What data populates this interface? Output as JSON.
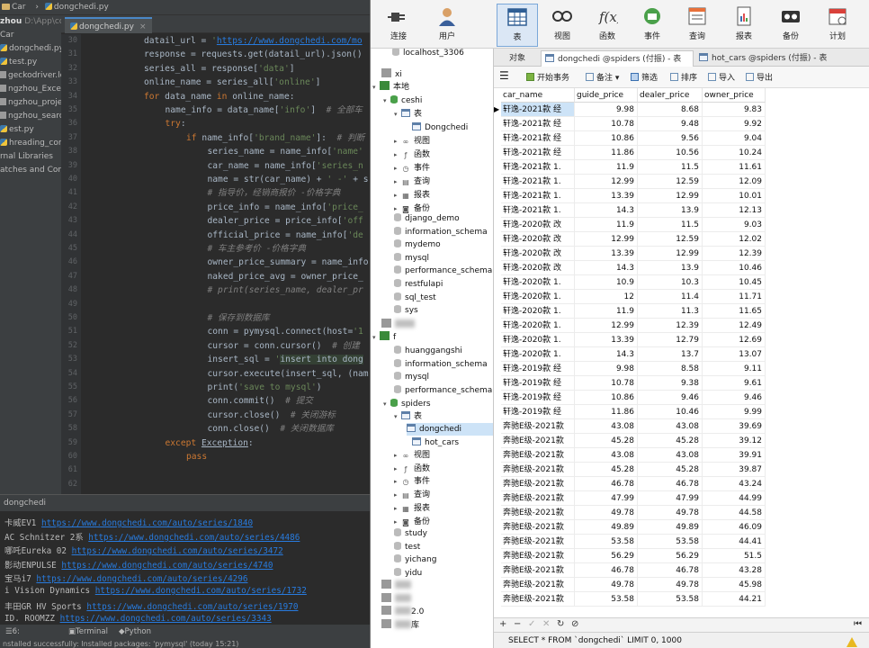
{
  "ide": {
    "breadcrumb": [
      "Car",
      "dongchedi.py"
    ],
    "project": {
      "items": [
        {
          "label": "zhou",
          "extra": "D:\\App\\cc",
          "bold": true
        },
        {
          "label": "Car"
        },
        {
          "label": "dongchedi.py",
          "icon": "py"
        },
        {
          "label": "test.py",
          "icon": "py"
        },
        {
          "label": "geckodriver.log",
          "icon": "txt"
        },
        {
          "label": "ngzhou_Excelpre",
          "icon": "txt"
        },
        {
          "label": "ngzhou_project.",
          "icon": "txt"
        },
        {
          "label": "ngzhou_search.p",
          "icon": "txt"
        },
        {
          "label": "est.py",
          "icon": "py"
        },
        {
          "label": "hreading_conditi",
          "icon": "py"
        },
        {
          "label": "rnal Libraries"
        },
        {
          "label": "atches and Consc"
        }
      ]
    },
    "editor_tab": "dongchedi.py",
    "line_numbers": [
      "30",
      "31",
      "32",
      "33",
      "34",
      "35",
      "36",
      "37",
      "38",
      "39",
      "40",
      "41",
      "42",
      "43",
      "44",
      "45",
      "46",
      "47",
      "48",
      "49",
      "50",
      "51",
      "52",
      "53",
      "54",
      "55",
      "56",
      "57",
      "58",
      "59",
      "60",
      "61",
      "62"
    ],
    "code": [
      {
        "i": 0,
        "parts": [
          [
            "",
            "datail_url = "
          ],
          [
            "st",
            "'"
          ],
          [
            "url",
            "https://www.dongchedi.com/mo"
          ]
        ]
      },
      {
        "i": 0,
        "parts": [
          [
            "",
            "response = requests.get(datail_url).json()"
          ]
        ]
      },
      {
        "i": 0,
        "parts": [
          [
            "",
            "series_all = response["
          ],
          [
            "st",
            "'data'"
          ],
          [
            "",
            "]"
          ]
        ]
      },
      {
        "i": 0,
        "parts": [
          [
            "",
            "online_name = series_all["
          ],
          [
            "st",
            "'online'"
          ],
          [
            "",
            "]"
          ]
        ]
      },
      {
        "i": 0,
        "parts": [
          [
            "kw",
            "for "
          ],
          [
            "",
            "data_name "
          ],
          [
            "kw",
            "in "
          ],
          [
            "",
            "online_name:"
          ]
        ]
      },
      {
        "i": 1,
        "parts": [
          [
            "",
            "name_info = data_name["
          ],
          [
            "st",
            "'info'"
          ],
          [
            "",
            "]  "
          ],
          [
            "cm",
            "# 全部车"
          ]
        ]
      },
      {
        "i": 1,
        "parts": [
          [
            "kw",
            "try"
          ],
          [
            "",
            ":"
          ]
        ]
      },
      {
        "i": 2,
        "parts": [
          [
            "kw",
            "if "
          ],
          [
            "",
            "name_info["
          ],
          [
            "st",
            "'brand_name'"
          ],
          [
            "",
            "]:  "
          ],
          [
            "cm",
            "# 判断"
          ]
        ]
      },
      {
        "i": 3,
        "parts": [
          [
            "",
            "series_name = name_info["
          ],
          [
            "st",
            "'name'"
          ]
        ]
      },
      {
        "i": 3,
        "parts": [
          [
            "",
            "car_name = name_info["
          ],
          [
            "st",
            "'series_n"
          ]
        ]
      },
      {
        "i": 3,
        "parts": [
          [
            "",
            "name = str(car_name) + "
          ],
          [
            "st",
            "' -' "
          ],
          [
            "",
            "+ s"
          ]
        ]
      },
      {
        "i": 3,
        "parts": [
          [
            "cm",
            "# 指导价，经销商报价 -价格字典"
          ]
        ]
      },
      {
        "i": 3,
        "parts": [
          [
            "",
            "price_info = name_info["
          ],
          [
            "st",
            "'price_"
          ]
        ]
      },
      {
        "i": 3,
        "parts": [
          [
            "",
            "dealer_price = price_info["
          ],
          [
            "st",
            "'off"
          ]
        ]
      },
      {
        "i": 3,
        "parts": [
          [
            "",
            "official_price = name_info["
          ],
          [
            "st",
            "'de"
          ]
        ]
      },
      {
        "i": 3,
        "parts": [
          [
            "cm",
            "# 车主参考价 -价格字典"
          ]
        ]
      },
      {
        "i": 3,
        "parts": [
          [
            "",
            "owner_price_summary = name_info"
          ]
        ]
      },
      {
        "i": 3,
        "parts": [
          [
            "",
            "naked_price_avg = owner_price_"
          ]
        ]
      },
      {
        "i": 3,
        "parts": [
          [
            "cm",
            "# print(series_name, dealer_pr"
          ]
        ]
      },
      {
        "i": 3,
        "parts": [
          [
            "",
            ""
          ]
        ]
      },
      {
        "i": 3,
        "parts": [
          [
            "cm",
            "# 保存到数据库"
          ]
        ]
      },
      {
        "i": 3,
        "parts": [
          [
            "",
            "conn = pymysql.connect(host="
          ],
          [
            "st",
            "'1"
          ]
        ]
      },
      {
        "i": 3,
        "parts": [
          [
            "",
            "cursor = conn.cursor()  "
          ],
          [
            "cm",
            "# 创建"
          ]
        ]
      },
      {
        "i": 3,
        "parts": [
          [
            "",
            "insert_sql = "
          ],
          [
            "st",
            "'"
          ],
          [
            "hl",
            "insert into dong"
          ]
        ]
      },
      {
        "i": 3,
        "parts": [
          [
            "",
            "cursor.execute(insert_sql, (nam"
          ]
        ]
      },
      {
        "i": 3,
        "parts": [
          [
            "",
            "print("
          ],
          [
            "st",
            "'save to mysql'"
          ],
          [
            "",
            ")"
          ]
        ]
      },
      {
        "i": 3,
        "parts": [
          [
            "",
            "conn.commit()  "
          ],
          [
            "cm",
            "# 提交"
          ]
        ]
      },
      {
        "i": 3,
        "parts": [
          [
            "",
            "cursor.close()  "
          ],
          [
            "cm",
            "# 关闭游标"
          ]
        ]
      },
      {
        "i": 3,
        "parts": [
          [
            "",
            "conn.close()  "
          ],
          [
            "cm",
            "# 关闭数据库"
          ]
        ]
      },
      {
        "i": 1,
        "parts": [
          [
            "kw",
            "except "
          ],
          [
            "ex",
            "Exception"
          ],
          [
            "",
            ":"
          ]
        ]
      },
      {
        "i": 2,
        "parts": [
          [
            "kw",
            "pass"
          ]
        ]
      },
      {
        "i": 0,
        "parts": [
          [
            "",
            ""
          ]
        ]
      },
      {
        "i": 0,
        "parts": [
          [
            "",
            ""
          ]
        ]
      }
    ],
    "run_title": "dongchedi",
    "output": [
      {
        "name": "卡威EV1 ",
        "url": "https://www.dongchedi.com/auto/series/1840"
      },
      {
        "name": "AC Schnitzer 2系 ",
        "url": "https://www.dongchedi.com/auto/series/4486"
      },
      {
        "name": "哪吒Eureka 02 ",
        "url": "https://www.dongchedi.com/auto/series/3472"
      },
      {
        "name": "影动ENPULSE ",
        "url": "https://www.dongchedi.com/auto/series/4740"
      },
      {
        "name": "宝马i7 ",
        "url": "https://www.dongchedi.com/auto/series/4296"
      },
      {
        "name": "i Vision Dynamics ",
        "url": "https://www.dongchedi.com/auto/series/1732"
      },
      {
        "name": "丰田GR HV Sports ",
        "url": "https://www.dongchedi.com/auto/series/1970"
      },
      {
        "name": "ID. ROOMZZ ",
        "url": "https://www.dongchedi.com/auto/series/3343"
      }
    ],
    "bottom_tools": [
      "6: TODO",
      "Terminal",
      "Python Console"
    ],
    "status": "nstalled successfully: Installed packages: 'pymysql' (today 15:21)"
  },
  "navicat": {
    "toolbar": [
      {
        "label": "连接",
        "icon": "plug-icon"
      },
      {
        "label": "用户",
        "icon": "user-icon"
      },
      {
        "label": "表",
        "icon": "table-icon",
        "active": true
      },
      {
        "label": "视图",
        "icon": "view-icon"
      },
      {
        "label": "函数",
        "icon": "function-icon"
      },
      {
        "label": "事件",
        "icon": "event-icon"
      },
      {
        "label": "查询",
        "icon": "query-icon"
      },
      {
        "label": "报表",
        "icon": "report-icon"
      },
      {
        "label": "备份",
        "icon": "backup-icon"
      },
      {
        "label": "计划",
        "icon": "schedule-icon"
      }
    ],
    "tree": {
      "top_partial": "localhost_3306",
      "xi": "xi",
      "local": "本地",
      "ceshi": "ceshi",
      "table_group": "表",
      "ceshi_table": "Dongchedi",
      "ceshi_children": [
        "视图",
        "函数",
        "事件",
        "查询",
        "报表",
        "备份"
      ],
      "dbs1": [
        "django_demo",
        "information_schema",
        "mydemo",
        "mysql",
        "performance_schema",
        "restfulapi",
        "sql_test",
        "sys"
      ],
      "conn2_label": "f",
      "dbs2": [
        "huanggangshi",
        "information_schema",
        "mysql",
        "performance_schema"
      ],
      "spiders": "spiders",
      "spiders_tables": [
        "dongchedi",
        "hot_cars"
      ],
      "spiders_children": [
        "视图",
        "函数",
        "事件",
        "查询",
        "报表",
        "备份"
      ],
      "dbs3": [
        "study",
        "test",
        "yichang",
        "yidu"
      ],
      "bottom_conns": [
        "",
        "",
        "2.0",
        "库"
      ]
    },
    "tabs": [
      "对象",
      "dongchedi @spiders (付振) - 表",
      "hot_cars @spiders (付振) - 表"
    ],
    "actions": [
      "开始事务",
      "备注",
      "筛选",
      "排序",
      "导入",
      "导出"
    ],
    "columns": [
      "car_name",
      "guide_price",
      "dealer_price",
      "owner_price"
    ],
    "rows": [
      [
        "轩逸-2021款 经",
        "9.98",
        "8.68",
        "9.83"
      ],
      [
        "轩逸-2021款 经",
        "10.78",
        "9.48",
        "9.92"
      ],
      [
        "轩逸-2021款 经",
        "10.86",
        "9.56",
        "9.04"
      ],
      [
        "轩逸-2021款 经",
        "11.86",
        "10.56",
        "10.24"
      ],
      [
        "轩逸-2021款 1.",
        "11.9",
        "11.5",
        "11.61"
      ],
      [
        "轩逸-2021款 1.",
        "12.99",
        "12.59",
        "12.09"
      ],
      [
        "轩逸-2021款 1.",
        "13.39",
        "12.99",
        "10.01"
      ],
      [
        "轩逸-2021款 1.",
        "14.3",
        "13.9",
        "12.13"
      ],
      [
        "轩逸-2020款 改",
        "11.9",
        "11.5",
        "9.03"
      ],
      [
        "轩逸-2020款 改",
        "12.99",
        "12.59",
        "12.02"
      ],
      [
        "轩逸-2020款 改",
        "13.39",
        "12.99",
        "12.39"
      ],
      [
        "轩逸-2020款 改",
        "14.3",
        "13.9",
        "10.46"
      ],
      [
        "轩逸-2020款 1.",
        "10.9",
        "10.3",
        "10.45"
      ],
      [
        "轩逸-2020款 1.",
        "12",
        "11.4",
        "11.71"
      ],
      [
        "轩逸-2020款 1.",
        "11.9",
        "11.3",
        "11.65"
      ],
      [
        "轩逸-2020款 1.",
        "12.99",
        "12.39",
        "12.49"
      ],
      [
        "轩逸-2020款 1.",
        "13.39",
        "12.79",
        "12.69"
      ],
      [
        "轩逸-2020款 1.",
        "14.3",
        "13.7",
        "13.07"
      ],
      [
        "轩逸-2019款 经",
        "9.98",
        "8.58",
        "9.11"
      ],
      [
        "轩逸-2019款 经",
        "10.78",
        "9.38",
        "9.61"
      ],
      [
        "轩逸-2019款 经",
        "10.86",
        "9.46",
        "9.46"
      ],
      [
        "轩逸-2019款 经",
        "11.86",
        "10.46",
        "9.99"
      ],
      [
        "奔驰E级-2021款",
        "43.08",
        "43.08",
        "39.69"
      ],
      [
        "奔驰E级-2021款",
        "45.28",
        "45.28",
        "39.12"
      ],
      [
        "奔驰E级-2021款",
        "43.08",
        "43.08",
        "39.91"
      ],
      [
        "奔驰E级-2021款",
        "45.28",
        "45.28",
        "39.87"
      ],
      [
        "奔驰E级-2021款",
        "46.78",
        "46.78",
        "43.24"
      ],
      [
        "奔驰E级-2021款",
        "47.99",
        "47.99",
        "44.99"
      ],
      [
        "奔驰E级-2021款",
        "49.78",
        "49.78",
        "44.58"
      ],
      [
        "奔驰E级-2021款",
        "49.89",
        "49.89",
        "46.09"
      ],
      [
        "奔驰E级-2021款",
        "53.58",
        "53.58",
        "44.41"
      ],
      [
        "奔驰E级-2021款",
        "56.29",
        "56.29",
        "51.5"
      ],
      [
        "奔驰E级-2021款",
        "46.78",
        "46.78",
        "43.28"
      ],
      [
        "奔驰E级-2021款",
        "49.78",
        "49.78",
        "45.98"
      ],
      [
        "奔驰E级-2021款",
        "53.58",
        "53.58",
        "44.21"
      ]
    ],
    "status_sql": "SELECT * FROM `dongchedi` LIMIT 0, 1000"
  }
}
